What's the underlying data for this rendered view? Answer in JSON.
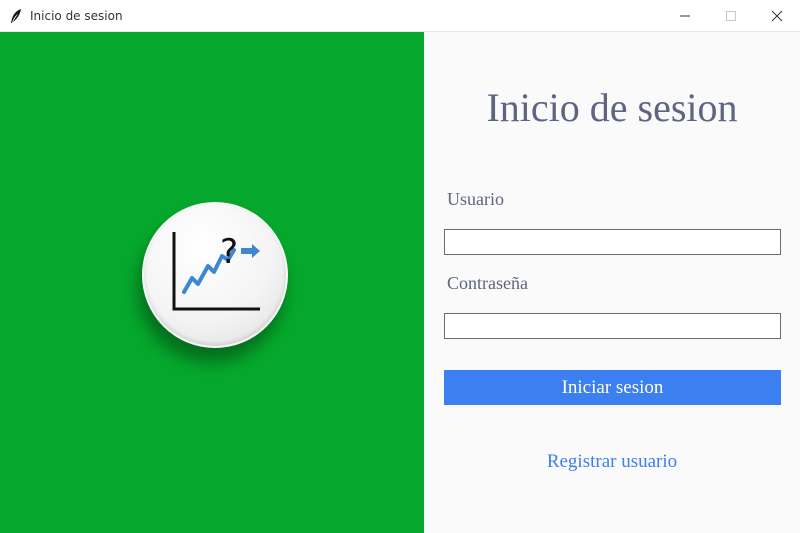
{
  "window": {
    "title": "Inicio de sesion",
    "app_icon": "feather-icon",
    "controls": [
      "minimize-icon",
      "maximize-icon",
      "close-icon"
    ]
  },
  "left_panel": {
    "background": "#05a82c",
    "logo_icon": "chart-question-icon"
  },
  "login": {
    "heading": "Inicio de sesion",
    "user_label": "Usuario",
    "user_value": "",
    "password_label": "Contraseña",
    "password_value": "",
    "submit_label": "Iniciar sesion",
    "register_label": "Registrar usuario"
  },
  "colors": {
    "accent": "#3b7ff0",
    "heading_text": "#5f6580",
    "panel_background": "#fafafa"
  }
}
